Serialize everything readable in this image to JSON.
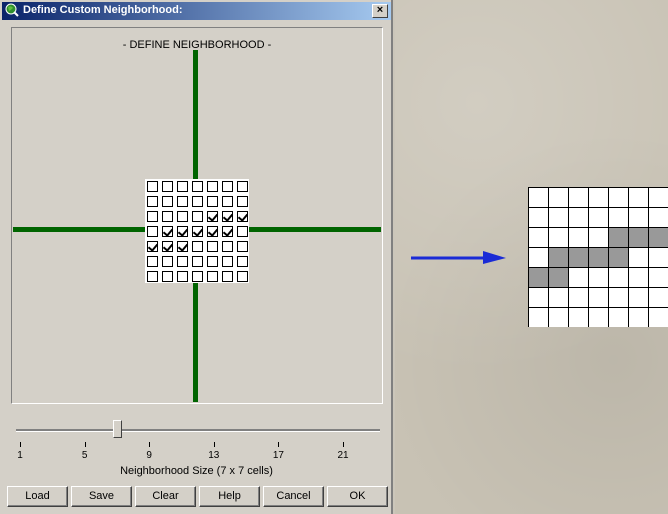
{
  "window": {
    "title": "Define Custom Neighborhood:",
    "close_label": "×"
  },
  "canvas": {
    "title": "- DEFINE NEIGHBORHOOD -",
    "axis_color": "#006400"
  },
  "neighborhood": {
    "rows": 7,
    "cols": 7,
    "checked": [
      [
        0,
        0,
        0,
        0,
        0,
        0,
        0
      ],
      [
        0,
        0,
        0,
        0,
        0,
        0,
        0
      ],
      [
        0,
        0,
        0,
        0,
        1,
        1,
        1
      ],
      [
        0,
        1,
        1,
        1,
        1,
        1,
        0
      ],
      [
        1,
        1,
        1,
        0,
        0,
        0,
        0
      ],
      [
        0,
        0,
        0,
        0,
        0,
        0,
        0
      ],
      [
        0,
        0,
        0,
        0,
        0,
        0,
        0
      ]
    ]
  },
  "slider": {
    "value": 7,
    "min": 1,
    "max": 25,
    "ticks": [
      "1",
      "5",
      "9",
      "13",
      "17",
      "21"
    ]
  },
  "size_label": "Neighborhood Size (7 x 7 cells)",
  "buttons": {
    "load": "Load",
    "save": "Save",
    "clear": "Clear",
    "help": "Help",
    "cancel": "Cancel",
    "ok": "OK"
  },
  "result_grid": {
    "rows": 7,
    "cols": 7,
    "filled": [
      [
        0,
        0,
        0,
        0,
        0,
        0,
        0
      ],
      [
        0,
        0,
        0,
        0,
        0,
        0,
        0
      ],
      [
        0,
        0,
        0,
        0,
        1,
        1,
        1
      ],
      [
        0,
        1,
        1,
        1,
        1,
        0,
        0
      ],
      [
        1,
        1,
        0,
        0,
        0,
        0,
        0
      ],
      [
        0,
        0,
        0,
        0,
        0,
        0,
        0
      ],
      [
        0,
        0,
        0,
        0,
        0,
        0,
        0
      ]
    ],
    "fill_color": "#999999"
  },
  "colors": {
    "titlebar_start": "#0a246a",
    "titlebar_end": "#a6caf0",
    "arrow": "#1a2bd6"
  }
}
